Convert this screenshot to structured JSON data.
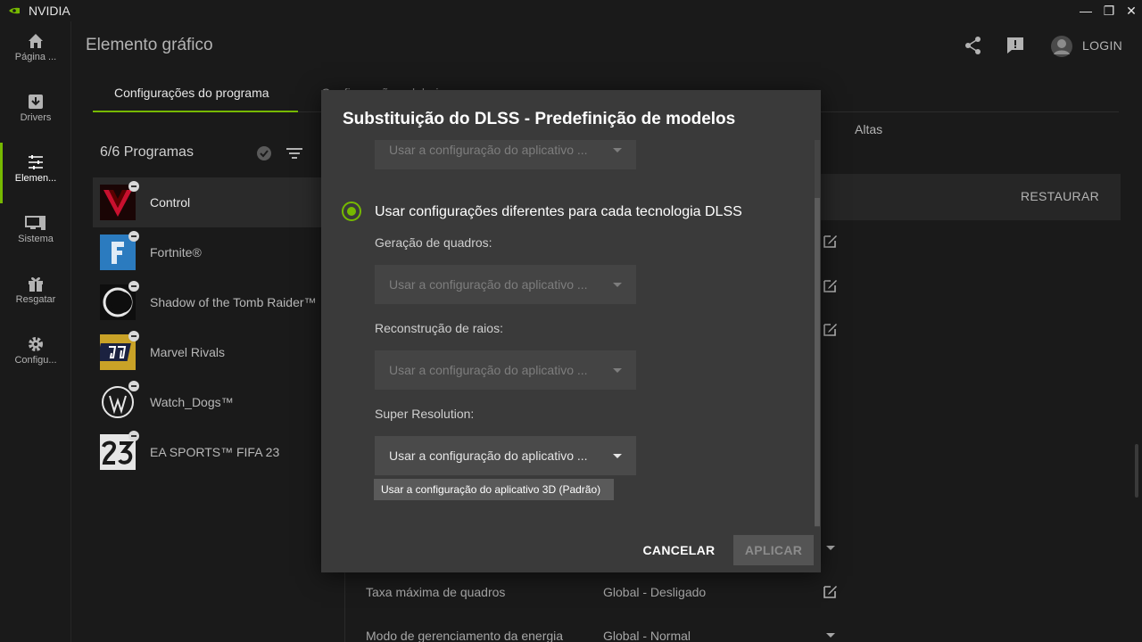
{
  "app": {
    "title": "NVIDIA",
    "accent": "#76b900"
  },
  "window_controls": {
    "minimize": "—",
    "restore": "❐",
    "close": "✕"
  },
  "nav": [
    {
      "label": "Página ...",
      "icon": "home-icon"
    },
    {
      "label": "Drivers",
      "icon": "download-icon"
    },
    {
      "label": "Elemen...",
      "icon": "sliders-icon"
    },
    {
      "label": "Sistema",
      "icon": "monitor-icon"
    },
    {
      "label": "Resgatar",
      "icon": "gift-icon"
    },
    {
      "label": "Configu...",
      "icon": "gear-icon"
    }
  ],
  "header": {
    "title": "Elemento gráfico",
    "login": "LOGIN"
  },
  "tabs": [
    {
      "label": "Configurações do programa"
    },
    {
      "label": "Configurações globais"
    }
  ],
  "programs": {
    "count": "6/6 Programas",
    "items": [
      {
        "name": "Control"
      },
      {
        "name": "Fortnite®"
      },
      {
        "name": "Shadow of the Tomb Raider™"
      },
      {
        "name": "Marvel Rivals"
      },
      {
        "name": "Watch_Dogs™"
      },
      {
        "name": "EA SPORTS™ FIFA 23"
      }
    ]
  },
  "background_panel": {
    "column_header": "Altas",
    "restore": "RESTAURAR",
    "rows": [
      {
        "label": "Taxa máxima de quadros",
        "value": "Global - Desligado"
      },
      {
        "label": "Modo de gerenciamento da energia",
        "value": "Global - Normal"
      }
    ]
  },
  "modal": {
    "title": "Substituição do DLSS - Predefinição de modelos",
    "top_dropdown_value": "Usar a configuração do aplicativo ...",
    "radio_label": "Usar configurações diferentes para cada tecnologia DLSS",
    "fields": [
      {
        "label": "Geração de quadros:",
        "value": "Usar a configuração do aplicativo ..."
      },
      {
        "label": "Reconstrução de raios:",
        "value": "Usar a configuração do aplicativo ..."
      },
      {
        "label": "Super Resolution:",
        "value": "Usar a configuração do aplicativo ..."
      }
    ],
    "tooltip": "Usar a configuração do aplicativo 3D (Padrão)",
    "cancel": "CANCELAR",
    "apply": "APLICAR"
  }
}
